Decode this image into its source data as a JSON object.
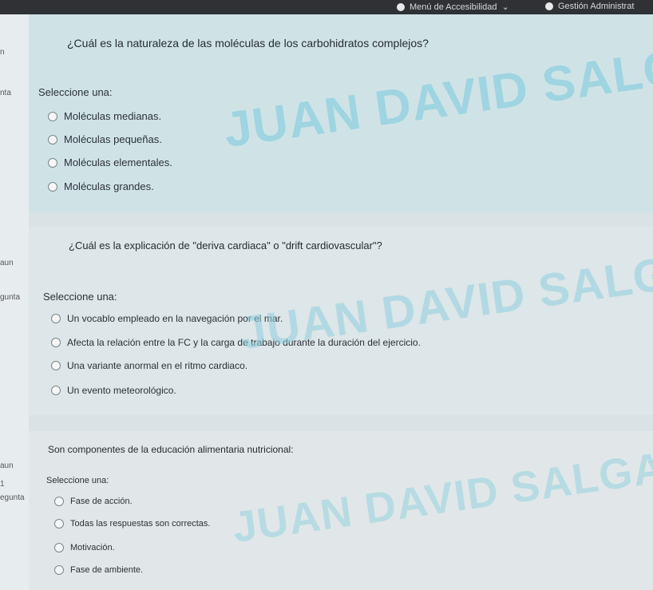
{
  "topbar": {
    "accessibility_menu": "Menú de Accesibilidad",
    "admin_menu": "Gestión Administrat"
  },
  "left_labels": [
    "n",
    "nta",
    "aun",
    "gunta",
    "aun",
    "1",
    "egunta"
  ],
  "watermark": "JUAN DAVID SALGADO",
  "questions": [
    {
      "text": "¿Cuál es la naturaleza de las moléculas de los carbohidratos complejos?",
      "select_label": "Seleccione una:",
      "options": [
        "Moléculas medianas.",
        "Moléculas pequeñas.",
        "Moléculas elementales.",
        "Moléculas grandes."
      ]
    },
    {
      "text": "¿Cuál es la explicación de \"deriva cardiaca\" o \"drift cardiovascular\"?",
      "select_label": "Seleccione una:",
      "options": [
        "Un vocablo empleado en la navegación por el mar.",
        "Afecta la relación entre la FC y la carga de trabajo durante la duración del ejercicio.",
        "Una variante anormal en el ritmo cardiaco.",
        "Un evento meteorológico."
      ]
    },
    {
      "text": "Son componentes de la educación alimentaria nutricional:",
      "select_label": "Seleccione una:",
      "options": [
        "Fase de acción.",
        "Todas las respuestas son correctas.",
        "Motivación.",
        "Fase de ambiente."
      ]
    }
  ]
}
